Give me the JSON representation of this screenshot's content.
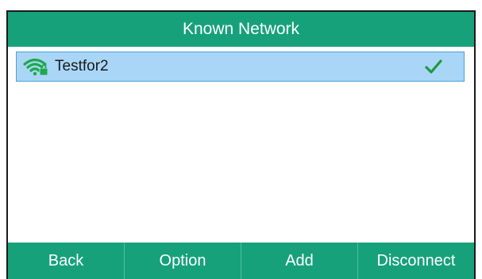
{
  "header": {
    "title": "Known Network"
  },
  "networks": [
    {
      "name": "Testfor2",
      "icon": "wifi-locked-icon",
      "connected": true,
      "check_icon": "checkmark-icon"
    }
  ],
  "softkeys": [
    {
      "label": "Back"
    },
    {
      "label": "Option"
    },
    {
      "label": "Add"
    },
    {
      "label": "Disconnect"
    }
  ],
  "colors": {
    "accent": "#17a17b",
    "selection": "#a9d6f7",
    "selection_border": "#4f9fd8",
    "wifi_icon": "#1fa84a",
    "check": "#1f9a3c"
  }
}
